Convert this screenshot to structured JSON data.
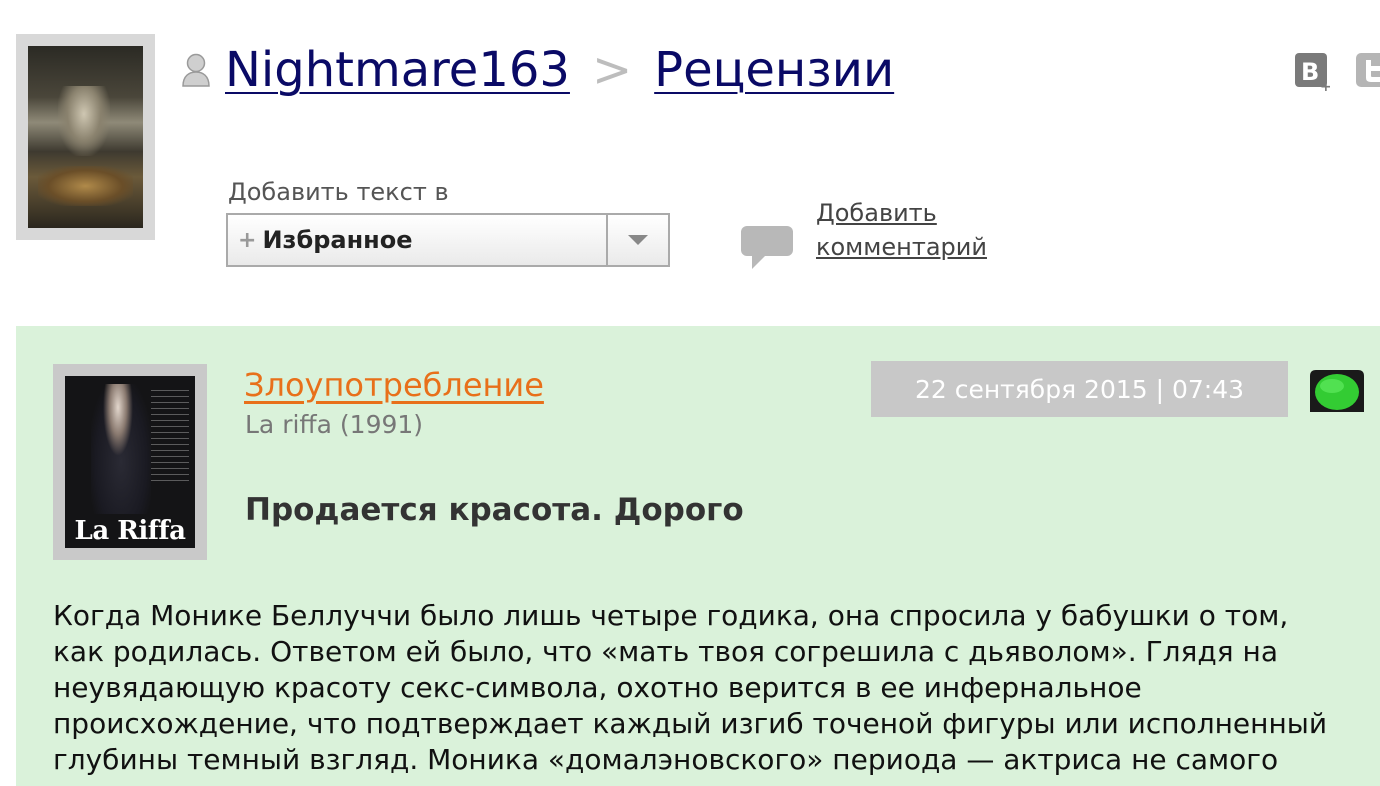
{
  "header": {
    "user_name": "Nightmare163",
    "separator": ">",
    "section": "Рецензии"
  },
  "favorites": {
    "label": "Добавить текст в",
    "plus": "+",
    "selected": "Избранное"
  },
  "comment": {
    "line1": "Добавить",
    "line2": "комментарий"
  },
  "share": {
    "vk_icon": "vk-icon",
    "twitter_icon": "twitter-icon"
  },
  "review": {
    "film_title": "Злоупотребление",
    "film_original": "La riffa (1991)",
    "poster_title": "La Riffa",
    "date": "22 сентября 2015 | 07:43",
    "status_color": "#33cc33",
    "title": "Продается красота. Дорого",
    "text": "Когда Монике Беллуччи было лишь четыре годика, она спросила у бабушки о том, как родилась. Ответом ей было, что «мать твоя согрешила с дьяволом». Глядя на неувядающую красоту секс-символа, охотно верится в ее инфернальное происхождение, что подтверждает каждый изгиб точеной фигуры или исполненный глубины темный взгляд. Моника «домалэновского» периода — актриса не самого"
  },
  "colors": {
    "review_bg": "#daf2da",
    "link_orange": "#e8701a",
    "link_dark": "#0a0a66"
  }
}
